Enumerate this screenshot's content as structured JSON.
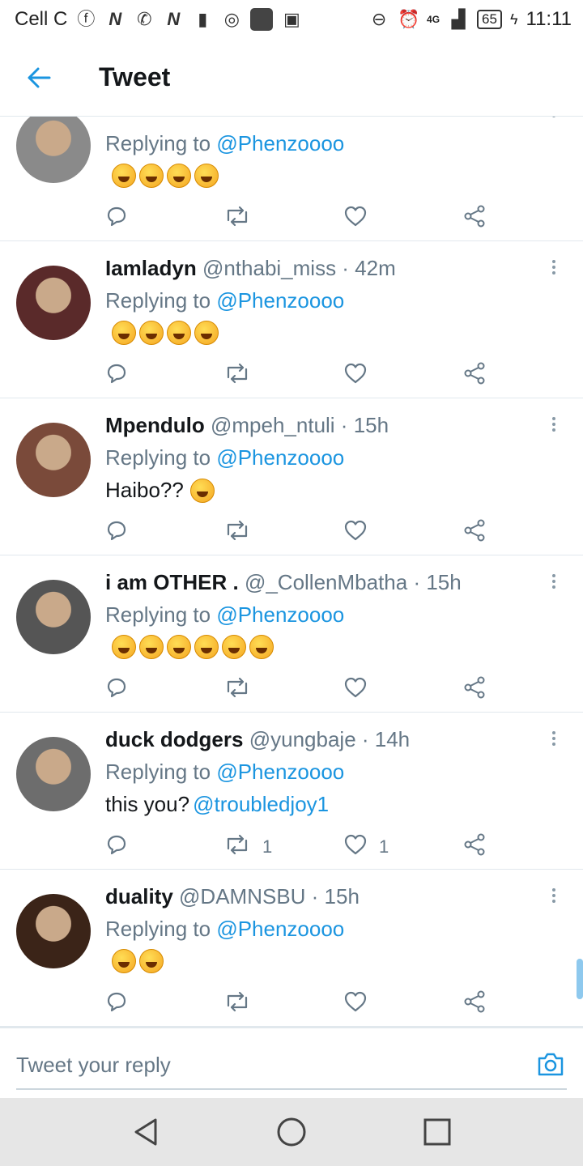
{
  "status_bar": {
    "carrier": "Cell C",
    "time": "11:11",
    "battery": "65",
    "network": "4G",
    "icons": [
      "facebook-icon",
      "n-icon",
      "whatsapp-icon",
      "n-icon",
      "sd-card-icon",
      "cast-icon",
      "app-icon",
      "gallery-icon",
      "dnd-icon",
      "alarm-icon",
      "signal-icon",
      "battery-icon"
    ]
  },
  "header": {
    "title": "Tweet",
    "back_icon": "arrow-left-icon"
  },
  "colors": {
    "accent": "#1b95e0",
    "secondary_text": "#657786",
    "primary_text": "#14171a",
    "divider": "#e1e8ed"
  },
  "tweets": [
    {
      "name": "",
      "handle": "",
      "time": "",
      "replying_label": "Replying to",
      "replying_to": "@Phenzoooo",
      "body_text": "",
      "mention": "",
      "emoji_count": 4,
      "retweets": "",
      "likes": ""
    },
    {
      "name": "Iamladyn",
      "handle": "@nthabi_miss · 42m",
      "time": "42m",
      "replying_label": "Replying to",
      "replying_to": "@Phenzoooo",
      "body_text": "",
      "mention": "",
      "emoji_count": 4,
      "retweets": "",
      "likes": ""
    },
    {
      "name": "Mpendulo",
      "handle": "@mpeh_ntuli · 15h",
      "time": "15h",
      "replying_label": "Replying to",
      "replying_to": "@Phenzoooo",
      "body_text": "Haibo??",
      "mention": "",
      "emoji_count": 1,
      "retweets": "",
      "likes": ""
    },
    {
      "name": "i am OTHER .",
      "handle": "@_CollenMbatha · 15h",
      "time": "15h",
      "replying_label": "Replying to",
      "replying_to": "@Phenzoooo",
      "body_text": "",
      "mention": "",
      "emoji_count": 6,
      "retweets": "",
      "likes": ""
    },
    {
      "name": "duck dodgers",
      "handle": "@yungbaje · 14h",
      "time": "14h",
      "replying_label": "Replying to",
      "replying_to": "@Phenzoooo",
      "body_text": "this you?",
      "mention": "@troubledjoy1",
      "emoji_count": 0,
      "retweets": "1",
      "likes": "1"
    },
    {
      "name": "duality",
      "handle": "@DAMNSBU · 15h",
      "time": "15h",
      "replying_label": "Replying to",
      "replying_to": "@Phenzoooo",
      "body_text": "",
      "mention": "",
      "emoji_count": 2,
      "retweets": "",
      "likes": ""
    }
  ],
  "composer": {
    "placeholder": "Tweet your reply",
    "camera_icon": "camera-icon"
  },
  "nav": {
    "back_icon": "nav-back-icon",
    "home_icon": "nav-home-icon",
    "recents_icon": "nav-recents-icon"
  }
}
